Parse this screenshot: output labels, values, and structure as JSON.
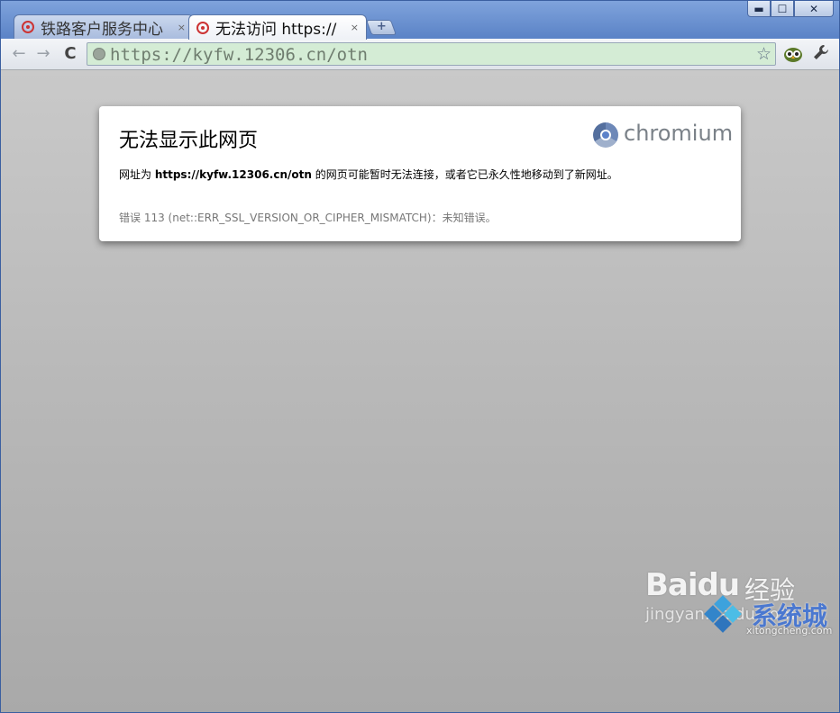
{
  "window": {
    "controls": {
      "minimize": "▬",
      "maximize": "☐",
      "close": "✕"
    }
  },
  "tabs": [
    {
      "title": "铁路客户服务中心",
      "close": "×",
      "active": false
    },
    {
      "title": "无法访问 https://",
      "close": "×",
      "active": true
    }
  ],
  "new_tab_label": "+",
  "toolbar": {
    "back": "←",
    "forward": "→",
    "reload": "C",
    "url": "https://kyfw.12306.cn/otn",
    "star": "☆",
    "wrench": "🔧"
  },
  "error_page": {
    "title": "无法显示此网页",
    "message_prefix": "网址为 ",
    "message_url": "https://kyfw.12306.cn/otn",
    "message_suffix": " 的网页可能暂时无法连接，或者它已永久性地移动到了新网址。",
    "error_code": "错误 113 (net::ERR_SSL_VERSION_OR_CIPHER_MISMATCH)：未知错误。",
    "brand": "chromium"
  },
  "watermark": {
    "baidu": "Baidu",
    "jingyan": "经验",
    "sub": "jingyan.baidu.com",
    "xitong": "系统城",
    "domain": "xitongcheng.com"
  }
}
